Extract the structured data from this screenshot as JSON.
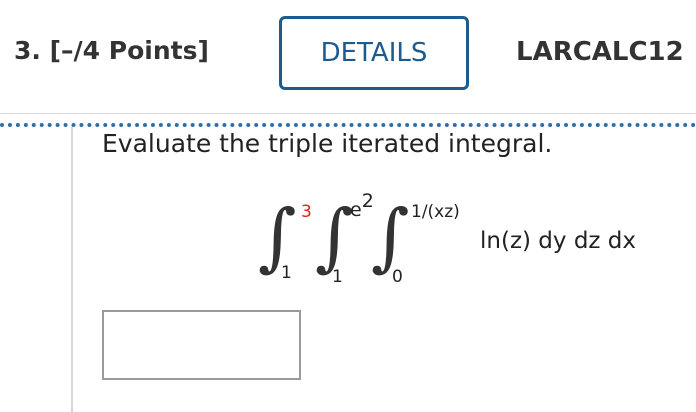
{
  "header": {
    "question_number": "3.  [–/4 Points]",
    "details_button": "DETAILS",
    "course_code": "LARCALC12"
  },
  "question": {
    "prompt": "Evaluate the triple iterated integral.",
    "integral": {
      "outer_upper": "3",
      "outer_lower": "1",
      "middle_upper_base": "e",
      "middle_upper_exponent": "2",
      "middle_lower": "1",
      "inner_upper": "1/(xz)",
      "inner_lower": "0",
      "integrand": "ln(z) dy dz dx"
    },
    "answer_value": ""
  },
  "colors": {
    "accent": "#1d5b8f",
    "divider_dots": "#2f6fb0",
    "highlight_limit": "#e0201a"
  }
}
